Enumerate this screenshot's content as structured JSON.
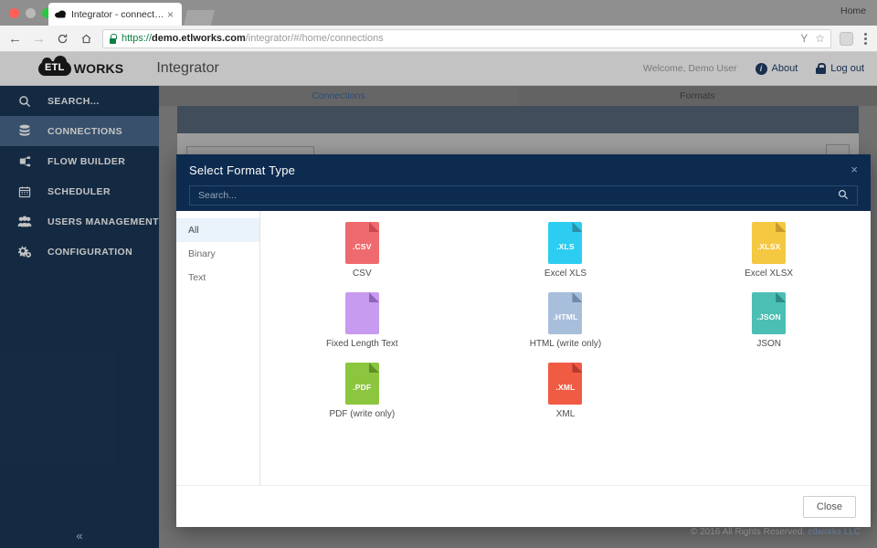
{
  "browser": {
    "tab_title": "Integrator - connections",
    "tab_close": "×",
    "home_label": "Home",
    "back_icon": "←",
    "forward_icon": "→",
    "reload_icon": "C",
    "home_icon": "⌂",
    "url_scheme": "https://",
    "url_host": "demo.etlworks.com",
    "url_path": "/integrator/#/home/connections",
    "filter_icon": "Υ",
    "star_icon": "☆"
  },
  "header": {
    "logo_mark": "ETL",
    "logo_word": "WORKS",
    "app_title": "Integrator",
    "welcome": "Welcome, Demo User",
    "about_label": "About",
    "about_icon": "i",
    "logout_label": "Log out"
  },
  "sidebar": {
    "items": [
      {
        "label": "SEARCH...",
        "icon": "🔍",
        "active": false
      },
      {
        "label": "CONNECTIONS",
        "icon": "⌸",
        "active": true
      },
      {
        "label": "FLOW BUILDER",
        "icon": "⎇",
        "active": false
      },
      {
        "label": "SCHEDULER",
        "icon": "Ὄ5",
        "active": false
      },
      {
        "label": "USERS MANAGEMENT",
        "icon": "👥",
        "active": false
      },
      {
        "label": "CONFIGURATION",
        "icon": "⚙",
        "active": false
      }
    ],
    "collapse_icon": "«"
  },
  "tabs": [
    {
      "label": "Connections",
      "active": true
    },
    {
      "label": "Formats",
      "active": false
    }
  ],
  "modal": {
    "title": "Select Format Type",
    "close_icon": "×",
    "search_placeholder": "Search...",
    "search_value": "",
    "search_icon": "⌕",
    "categories": [
      {
        "label": "All",
        "active": true
      },
      {
        "label": "Binary",
        "active": false
      },
      {
        "label": "Text",
        "active": false
      }
    ],
    "formats": [
      {
        "label": "CSV",
        "ext": ".CSV",
        "color": "#ef6a6e",
        "corner": "#c9474f"
      },
      {
        "label": "Excel XLS",
        "ext": ".XLS",
        "color": "#2ccdf0",
        "corner": "#2a8fa8"
      },
      {
        "label": "Excel XLSX",
        "ext": ".XLSX",
        "color": "#f5c842",
        "corner": "#c79a2b"
      },
      {
        "label": "Fixed Length Text",
        "ext": "",
        "color": "#c79bf0",
        "corner": "#8e63ba"
      },
      {
        "label": "HTML (write only)",
        "ext": ".HTML",
        "color": "#a8bfdc",
        "corner": "#6f89a8"
      },
      {
        "label": "JSON",
        "ext": ".JSON",
        "color": "#4bbfb4",
        "corner": "#2f8a86"
      },
      {
        "label": "PDF (write only)",
        "ext": ".PDF",
        "color": "#8cc63f",
        "corner": "#5f8f27"
      },
      {
        "label": "XML",
        "ext": ".XML",
        "color": "#f05b44",
        "corner": "#b93a2a"
      }
    ],
    "close_button": "Close"
  },
  "footer": {
    "copyright": "© 2016 All Rights Reserved.",
    "company": "etlworks LLC"
  }
}
